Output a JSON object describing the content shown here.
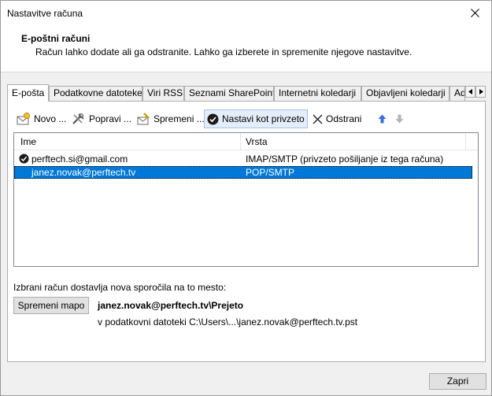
{
  "window": {
    "title": "Nastavitve računa"
  },
  "header": {
    "title": "E-poštni računi",
    "description": "Račun lahko dodate ali ga odstranite. Lahko ga izberete in spremenite njegove nastavitve."
  },
  "tabs": [
    {
      "label": "E-pošta",
      "active": true
    },
    {
      "label": "Podatkovne datoteke"
    },
    {
      "label": "Viri RSS"
    },
    {
      "label": "Seznami SharePoint"
    },
    {
      "label": "Internetni koledarji"
    },
    {
      "label": "Objavljeni koledarji"
    },
    {
      "label": "Ad"
    }
  ],
  "toolbar": {
    "new_label": "Novo ...",
    "repair_label": "Popravi ...",
    "change_label": "Spremeni ...",
    "set_default_label": "Nastavi kot privzeto",
    "remove_label": "Odstrani"
  },
  "accounts": {
    "columns": {
      "name": "Ime",
      "type": "Vrsta"
    },
    "rows": [
      {
        "name": "perftech.si@gmail.com",
        "type": "IMAP/SMTP (privzeto pošiljanje iz tega računa)",
        "default": true
      },
      {
        "name": "janez.novak@perftech.tv",
        "type": "POP/SMTP",
        "selected": true
      }
    ]
  },
  "delivery": {
    "label": "Izbrani račun dostavlja nova sporočila na to mesto:",
    "change_folder_label": "Spremeni mapo",
    "folder_path": "janez.novak@perftech.tv\\Prejeto",
    "data_file": "v podatkovni datoteki C:\\Users\\...\\janez.novak@perftech.tv.pst"
  },
  "footer": {
    "close_label": "Zapri"
  },
  "colors": {
    "selection": "#0078d7",
    "accent_arrow": "#3a6fd8"
  }
}
